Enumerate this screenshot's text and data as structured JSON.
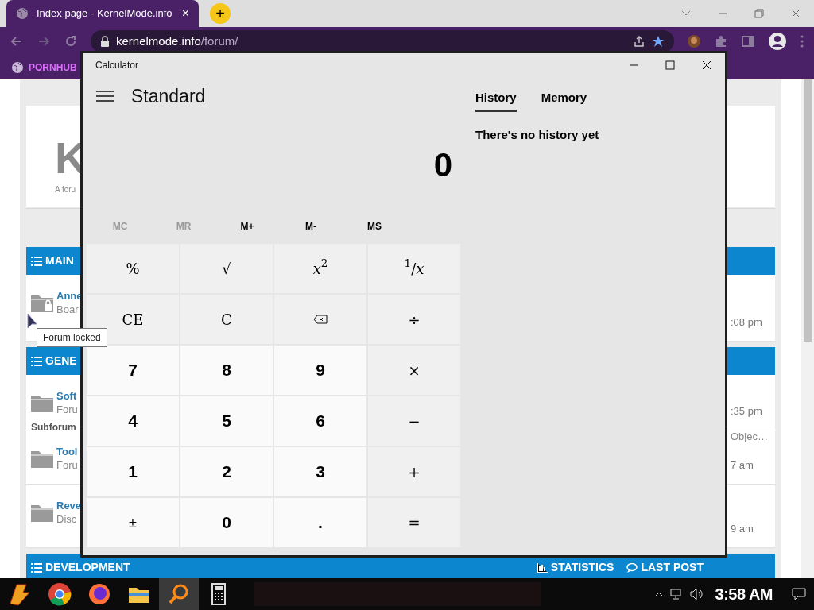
{
  "browser": {
    "tab": {
      "title": "Index page - KernelMode.info",
      "close": "×"
    },
    "new_tab": "+",
    "url": {
      "host": "kernelmode.info",
      "path": "/forum/"
    },
    "bookmarks": [
      {
        "label": "PORNHUB"
      }
    ]
  },
  "forum": {
    "logo": "K",
    "tagline": "A foru",
    "sections": [
      {
        "title": "MAIN",
        "rows": [
          {
            "title": "Anne",
            "desc": "Boar",
            "locked": true,
            "last": ":08 pm"
          }
        ]
      },
      {
        "title": "GENE",
        "rows": [
          {
            "title": "Soft",
            "desc": "Foru",
            "sub": "Subforum",
            "locked": false,
            "last": ":35 pm"
          },
          {
            "title": "Tool",
            "desc": "Foru",
            "locked": false,
            "last_title": "Objec…",
            "last": "7 am"
          },
          {
            "title": "Reve",
            "desc": "Disc",
            "locked": false,
            "last": "9 am"
          }
        ]
      }
    ],
    "footer_section": {
      "title": "DEVELOPMENT",
      "columns": [
        "STATISTICS",
        "LAST POST"
      ]
    }
  },
  "tooltip": "Forum locked",
  "calculator": {
    "title": "Calculator",
    "mode": "Standard",
    "display": "0",
    "memory": [
      {
        "label": "MC",
        "disabled": true
      },
      {
        "label": "MR",
        "disabled": true
      },
      {
        "label": "M+",
        "disabled": false
      },
      {
        "label": "M-",
        "disabled": false
      },
      {
        "label": "MS",
        "disabled": false
      }
    ],
    "keys": [
      {
        "kind": "op",
        "label": "%"
      },
      {
        "kind": "op",
        "label": "√"
      },
      {
        "kind": "op",
        "label": "*x*$^{2}$"
      },
      {
        "kind": "op",
        "label": "$^{1}$/*x*"
      },
      {
        "kind": "op",
        "label": "CE"
      },
      {
        "kind": "op",
        "label": "C"
      },
      {
        "kind": "backspace"
      },
      {
        "kind": "op",
        "label": "÷"
      },
      {
        "kind": "num",
        "label": "7"
      },
      {
        "kind": "num",
        "label": "8"
      },
      {
        "kind": "num",
        "label": "9"
      },
      {
        "kind": "op",
        "label": "×"
      },
      {
        "kind": "num",
        "label": "4"
      },
      {
        "kind": "num",
        "label": "5"
      },
      {
        "kind": "num",
        "label": "6"
      },
      {
        "kind": "op",
        "label": "−"
      },
      {
        "kind": "num",
        "label": "1"
      },
      {
        "kind": "num",
        "label": "2"
      },
      {
        "kind": "num",
        "label": "3"
      },
      {
        "kind": "op",
        "label": "+"
      },
      {
        "kind": "sign",
        "label": "±"
      },
      {
        "kind": "num",
        "label": "0"
      },
      {
        "kind": "num",
        "label": "."
      },
      {
        "kind": "op",
        "label": "="
      }
    ],
    "tabs": [
      {
        "label": "History",
        "selected": true
      },
      {
        "label": "Memory",
        "selected": false
      }
    ],
    "history_empty": "There's no history yet"
  },
  "taskbar": {
    "apps": [
      {
        "kind": "start",
        "active": false
      },
      {
        "kind": "chrome",
        "active": false
      },
      {
        "kind": "firefox",
        "active": false
      },
      {
        "kind": "folder",
        "active": false
      },
      {
        "kind": "search",
        "active": true
      },
      {
        "kind": "calculator",
        "active": false
      }
    ],
    "clock": "3:58 AM"
  }
}
